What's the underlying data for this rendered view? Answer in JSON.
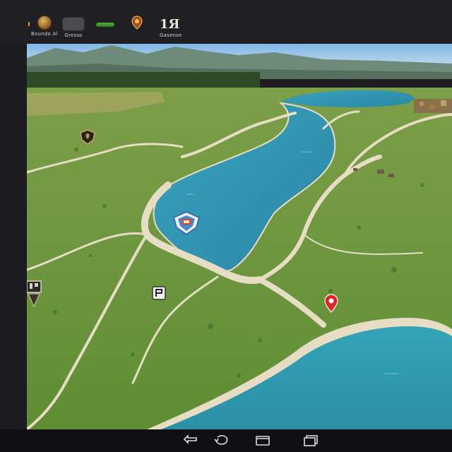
{
  "hud": {
    "gold_label": "Bounda Al",
    "menu_label": "Gresso",
    "green_label": "~",
    "counter_value": "1Я",
    "counter_label": "Gasense"
  },
  "map": {
    "lake_label": "~~~",
    "river_label": "~~",
    "sea_label": "~~~~"
  },
  "colors": {
    "grass": "#6e9a3c",
    "water": "#2f98b0",
    "path": "#e7ddc4",
    "sky": "#9cc8e8"
  },
  "icons": {
    "gold": "gold-coin-icon",
    "menu": "menu-pill-icon",
    "status": "green-bar-icon",
    "location": "location-pin-icon",
    "shield_marker": "shield-marker-icon",
    "flag_marker": "flag-marker-icon",
    "red_marker": "red-map-pin-icon",
    "castle_marker": "castle-marker-icon"
  },
  "nav": [
    "back-icon",
    "home-icon",
    "recent-apps-icon",
    "layers-icon"
  ]
}
